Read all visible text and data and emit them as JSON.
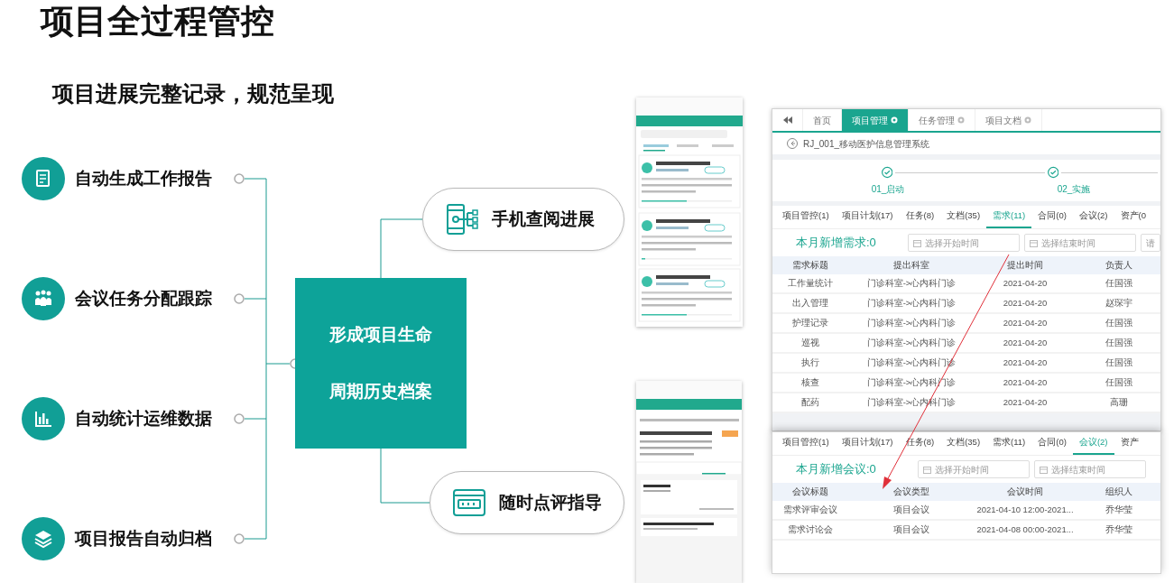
{
  "title": "项目全过程管控",
  "subtitle": "项目进展完整记录，规范呈现",
  "features": [
    {
      "label": "自动生成工作报告",
      "kind": "report"
    },
    {
      "label": "会议任务分配跟踪",
      "kind": "meeting"
    },
    {
      "label": "自动统计运维数据",
      "kind": "chart"
    },
    {
      "label": "项目报告自动归档",
      "kind": "archive"
    }
  ],
  "center": {
    "lines": [
      "形成项目生命",
      "周期历史档案"
    ]
  },
  "channels": [
    {
      "label": "手机查阅进展",
      "kind": "mobile"
    },
    {
      "label": "随时点评指导",
      "kind": "comment"
    }
  ],
  "desktop": {
    "tabs": [
      {
        "label": "首页",
        "selected": false,
        "closable": false
      },
      {
        "label": "项目管理",
        "selected": true,
        "closable": true
      },
      {
        "label": "任务管理",
        "selected": false,
        "closable": true
      },
      {
        "label": "项目文档",
        "selected": false,
        "closable": true
      }
    ],
    "project_title": "RJ_001_移动医护信息管理系统",
    "steps": [
      {
        "label": "01_启动"
      },
      {
        "label": "02_实施"
      }
    ],
    "panels": [
      {
        "subtabs": [
          {
            "label": "项目管控(1)",
            "selected": false
          },
          {
            "label": "项目计划(17)",
            "selected": false
          },
          {
            "label": "任务(8)",
            "selected": false
          },
          {
            "label": "文档(35)",
            "selected": false
          },
          {
            "label": "需求(11)",
            "selected": true
          },
          {
            "label": "合同(0)",
            "selected": false
          },
          {
            "label": "会议(2)",
            "selected": false
          },
          {
            "label": "资产(0",
            "selected": false
          }
        ],
        "summary": "本月新增需求:0",
        "fields": [
          {
            "placeholder": "选择开始时间"
          },
          {
            "placeholder": "选择结束时间"
          },
          {
            "placeholder": "请"
          }
        ],
        "columns": [
          "需求标题",
          "提出科室",
          "提出时间",
          "负责人"
        ],
        "rows": [
          [
            "工作量统计",
            "门诊科室->心内科门诊",
            "2021-04-20",
            "任国强"
          ],
          [
            "出入管理",
            "门诊科室->心内科门诊",
            "2021-04-20",
            "赵琛宇"
          ],
          [
            "护理记录",
            "门诊科室->心内科门诊",
            "2021-04-20",
            "任国强"
          ],
          [
            "巡视",
            "门诊科室->心内科门诊",
            "2021-04-20",
            "任国强"
          ],
          [
            "执行",
            "门诊科室->心内科门诊",
            "2021-04-20",
            "任国强"
          ],
          [
            "核查",
            "门诊科室->心内科门诊",
            "2021-04-20",
            "任国强"
          ],
          [
            "配药",
            "门诊科室->心内科门诊",
            "2021-04-20",
            "高珊"
          ]
        ]
      },
      {
        "subtabs": [
          {
            "label": "项目管控(1)",
            "selected": false
          },
          {
            "label": "项目计划(17)",
            "selected": false
          },
          {
            "label": "任务(8)",
            "selected": false
          },
          {
            "label": "文档(35)",
            "selected": false
          },
          {
            "label": "需求(11)",
            "selected": false
          },
          {
            "label": "合同(0)",
            "selected": false
          },
          {
            "label": "会议(2)",
            "selected": true
          },
          {
            "label": "资产",
            "selected": false
          }
        ],
        "summary": "本月新增会议:0",
        "fields": [
          {
            "placeholder": "选择开始时间"
          },
          {
            "placeholder": "选择结束时间"
          }
        ],
        "columns": [
          "会议标题",
          "会议类型",
          "会议时间",
          "组织人"
        ],
        "rows": [
          [
            "需求评审会议",
            "项目会议",
            "2021-04-10 12:00-2021...",
            "乔华莹"
          ],
          [
            "需求讨论会",
            "项目会议",
            "2021-04-08 00:00-2021...",
            "乔华莹"
          ]
        ]
      }
    ]
  }
}
